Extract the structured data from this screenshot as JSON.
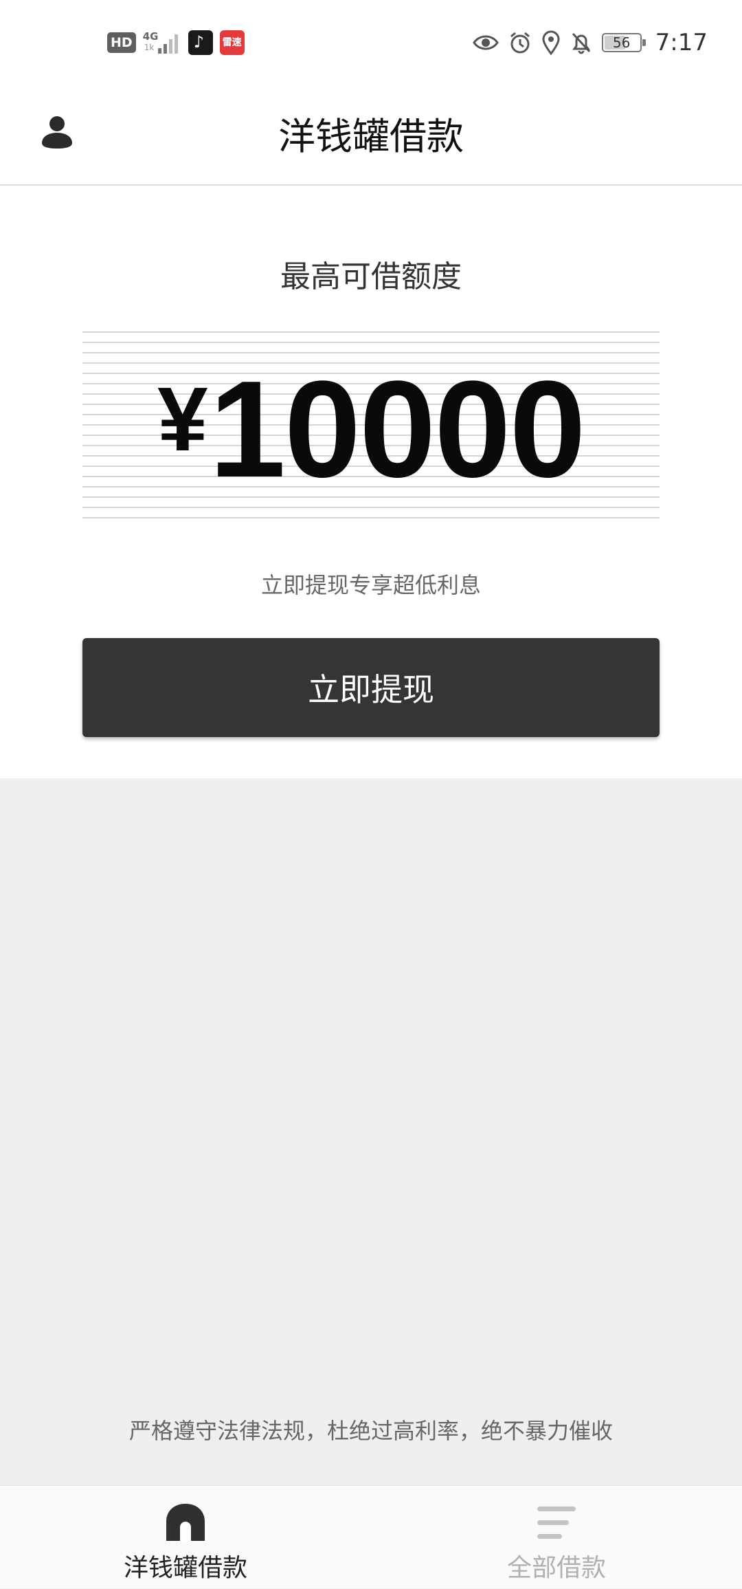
{
  "status_bar": {
    "hd_badge": "HD",
    "network": "4G",
    "network_sub": "1k",
    "app_badge": "雷速",
    "battery": "56",
    "time": "7:17"
  },
  "header": {
    "title": "洋钱罐借款",
    "profile_icon": "user-icon"
  },
  "main": {
    "limit_title": "最高可借额度",
    "currency": "¥",
    "amount": "10000",
    "promo": "立即提现专享超低利息",
    "withdraw_button": "立即提现"
  },
  "footer": {
    "legal_notice": "严格遵守法律法规，杜绝过高利率，绝不暴力催收"
  },
  "bottom_nav": {
    "items": [
      {
        "label": "洋钱罐借款",
        "icon": "home-icon",
        "active": true
      },
      {
        "label": "全部借款",
        "icon": "list-icon",
        "active": false
      }
    ]
  },
  "colors": {
    "button_bg": "#353535",
    "active_nav": "#222222",
    "inactive_nav": "#b0b0b0",
    "page_bg": "#efefef"
  }
}
